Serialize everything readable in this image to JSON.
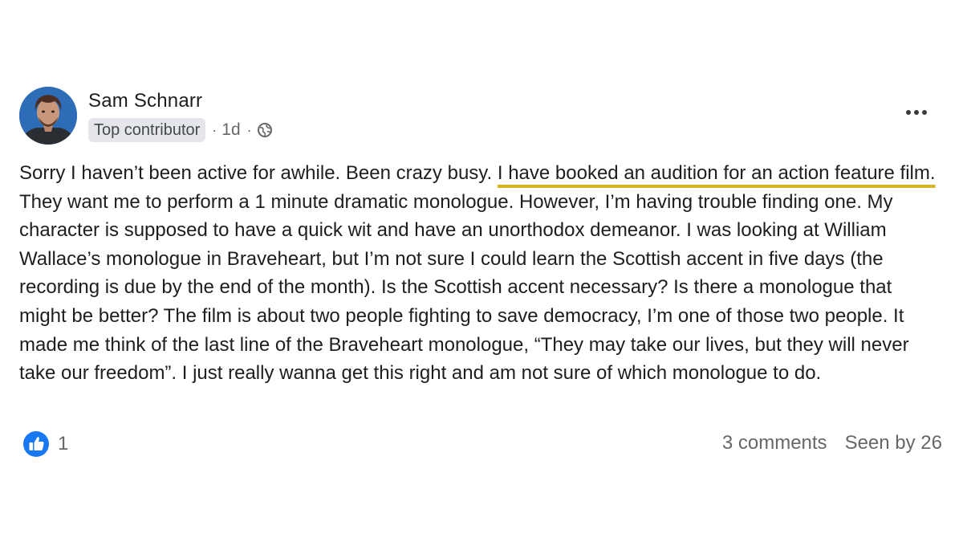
{
  "post": {
    "author": "Sam Schnarr",
    "badge": "Top contributor",
    "separator": "·",
    "time": "1d",
    "body": {
      "part1": "Sorry I haven’t been active for awhile. Been crazy busy. ",
      "highlight1": "I have booked an audition for an action feature film.",
      "part2": " They want me to perform a 1 minute dramatic monologue. However, I’m having trouble finding one. My character is supposed to have a quick wit and have an unorthodox demeanor. I was looking at William Wallace’s monologue in Braveheart, but I’m not sure I could learn the Scottish accent in five days (the recording is due by the end of the month). Is the Scottish accent necessary? Is there a monologue that might be better? The film is about two people fighting to save democracy, I’m one of those two people. It made me think of the last line of the Braveheart monologue, “They may take our lives, but they will never take our freedom”. I just really wanna get this right and am not sure of which monologue to do."
    },
    "reactions_count": "1",
    "comments": "3 comments",
    "seen_by": "Seen by 26"
  },
  "icons": {
    "privacy": "globe-icon",
    "more": "more-options-icon",
    "reaction": "like-icon"
  },
  "colors": {
    "highlight_underline": "#d8b623",
    "like_blue": "#1877f2",
    "secondary_text": "#65676b"
  }
}
